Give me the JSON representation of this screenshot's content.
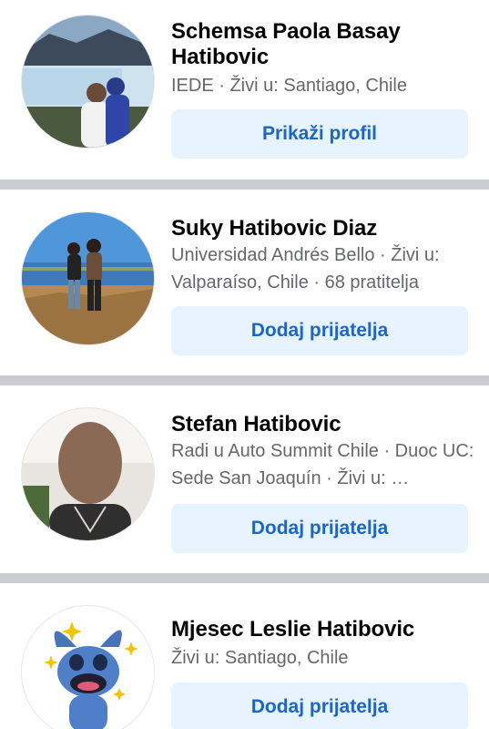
{
  "results": [
    {
      "name": "Schemsa Paola Basay Hatibovic",
      "details": "IEDE · Živi u: Santiago, Chile",
      "action_label": "Prikaži profil"
    },
    {
      "name": "Suky Hatibovic Diaz",
      "details": "Universidad Andrés Bello · Živi u: Valparaíso, Chile · 68 pratitelja",
      "action_label": "Dodaj prijatelja"
    },
    {
      "name": "Stefan Hatibovic",
      "details": "Radi u Auto Summit Chile · Duoc UC: Sede San Joaquín · Živi u: …",
      "action_label": "Dodaj prijatelja"
    },
    {
      "name": "Mjesec Leslie Hatibovic",
      "details": "Živi u: Santiago, Chile",
      "action_label": "Dodaj prijatelja"
    }
  ],
  "colors": {
    "button_bg": "#e7f3ff",
    "button_text": "#1b66c9",
    "divider": "#c9ccd1",
    "name_text": "#050505",
    "details_text": "#65676b"
  }
}
